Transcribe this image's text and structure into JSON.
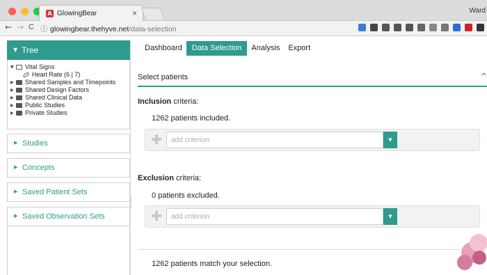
{
  "browser": {
    "tab_title": "GlowingBear",
    "tab_close": "×",
    "profile": "Ward",
    "url_host": "glowingbear.thehyve.net",
    "url_path": "/data-selection",
    "nav": {
      "back": "←",
      "forward": "→",
      "reload": "C"
    },
    "extensions": [
      "#3b7dd8",
      "#444444",
      "#555555",
      "#555555",
      "#555555",
      "#666666",
      "#888888",
      "#777777",
      "#2e6bd6",
      "#cc2222",
      "#333333"
    ]
  },
  "sidebar": {
    "tree": {
      "title": "Tree",
      "nodes": [
        {
          "label": "Vital Signs",
          "expanded": true
        },
        {
          "label": "Heart Rate (6 | 7)",
          "leaf": true
        },
        {
          "label": "Shared Samples and Timepoints"
        },
        {
          "label": "Shared Design Factors"
        },
        {
          "label": "Shared Clinical Data"
        },
        {
          "label": "Public Studies"
        },
        {
          "label": "Private Studies"
        }
      ]
    },
    "sections": [
      {
        "label": "Studies"
      },
      {
        "label": "Concepts"
      },
      {
        "label": "Saved Patient Sets"
      },
      {
        "label": "Saved Observation Sets"
      }
    ]
  },
  "main": {
    "tabs": [
      {
        "label": "Dashboard",
        "active": false
      },
      {
        "label": "Data Selection",
        "active": true
      },
      {
        "label": "Analysis",
        "active": false
      },
      {
        "label": "Export",
        "active": false
      }
    ],
    "section_title": "Select patients",
    "inclusion": {
      "label_bold": "Inclusion",
      "label_rest": " criteria:",
      "count_text": "1262 patients included.",
      "placeholder": "add criterion"
    },
    "exclusion": {
      "label_bold": "Exclusion",
      "label_rest": " criteria:",
      "count_text": "0 patients excluded.",
      "placeholder": "add criterion"
    },
    "match_text": "1262 patients match your selection."
  },
  "colors": {
    "accent": "#2e9b8d"
  }
}
